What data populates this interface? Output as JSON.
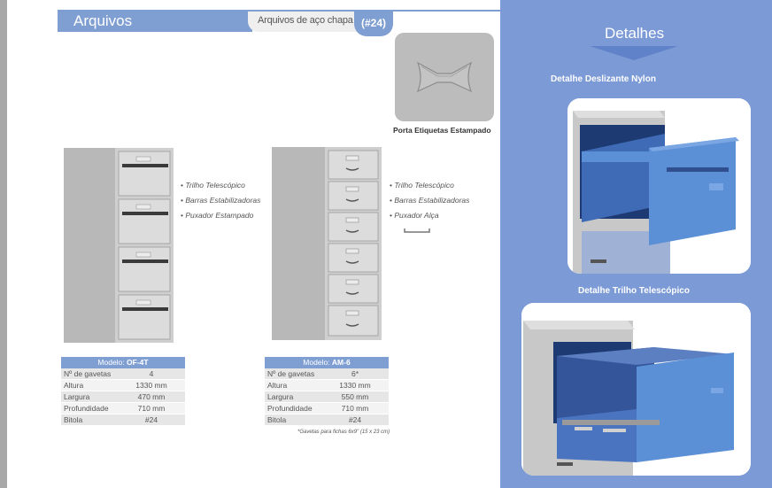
{
  "header": {
    "section_title": "Arquivos",
    "subtitle": "Arquivos de aço chapa",
    "badge": "(#24)"
  },
  "label_holder": {
    "caption": "Porta Etiquetas Estampado"
  },
  "products": [
    {
      "features": [
        "Trilho Telescópico",
        "Barras Estabilizadoras",
        "Puxador Estampado"
      ],
      "model_label": "Modelo:",
      "model": "OF-4T",
      "specs": [
        {
          "key": "Nº de gavetas",
          "value": "4"
        },
        {
          "key": "Altura",
          "value": "1330 mm"
        },
        {
          "key": "Largura",
          "value": "470 mm"
        },
        {
          "key": "Profundidade",
          "value": "710 mm"
        },
        {
          "key": "Bitola",
          "value": "#24"
        }
      ]
    },
    {
      "features": [
        "Trilho Telescópico",
        "Barras Estabilizadoras",
        "Puxador Alça"
      ],
      "model_label": "Modelo:",
      "model": "AM-6",
      "specs": [
        {
          "key": "Nº de gavetas",
          "value": "6*"
        },
        {
          "key": "Altura",
          "value": "1330 mm"
        },
        {
          "key": "Largura",
          "value": "550 mm"
        },
        {
          "key": "Profundidade",
          "value": "710 mm"
        },
        {
          "key": "Bitola",
          "value": "#24"
        }
      ],
      "footnote": "*Gavetas para fichas 6x9\" (15 x 23 cm)"
    }
  ],
  "details": {
    "title": "Detalhes",
    "items": [
      {
        "caption": "Detalhe Deslizante Nylon"
      },
      {
        "caption": "Detalhe Trilho Telescópico"
      }
    ]
  },
  "colors": {
    "accent": "#7f9fd3",
    "panel": "#7b9ad6",
    "cabinet": "#c9c9c9",
    "drawer_blue": "#5b8fd6"
  }
}
